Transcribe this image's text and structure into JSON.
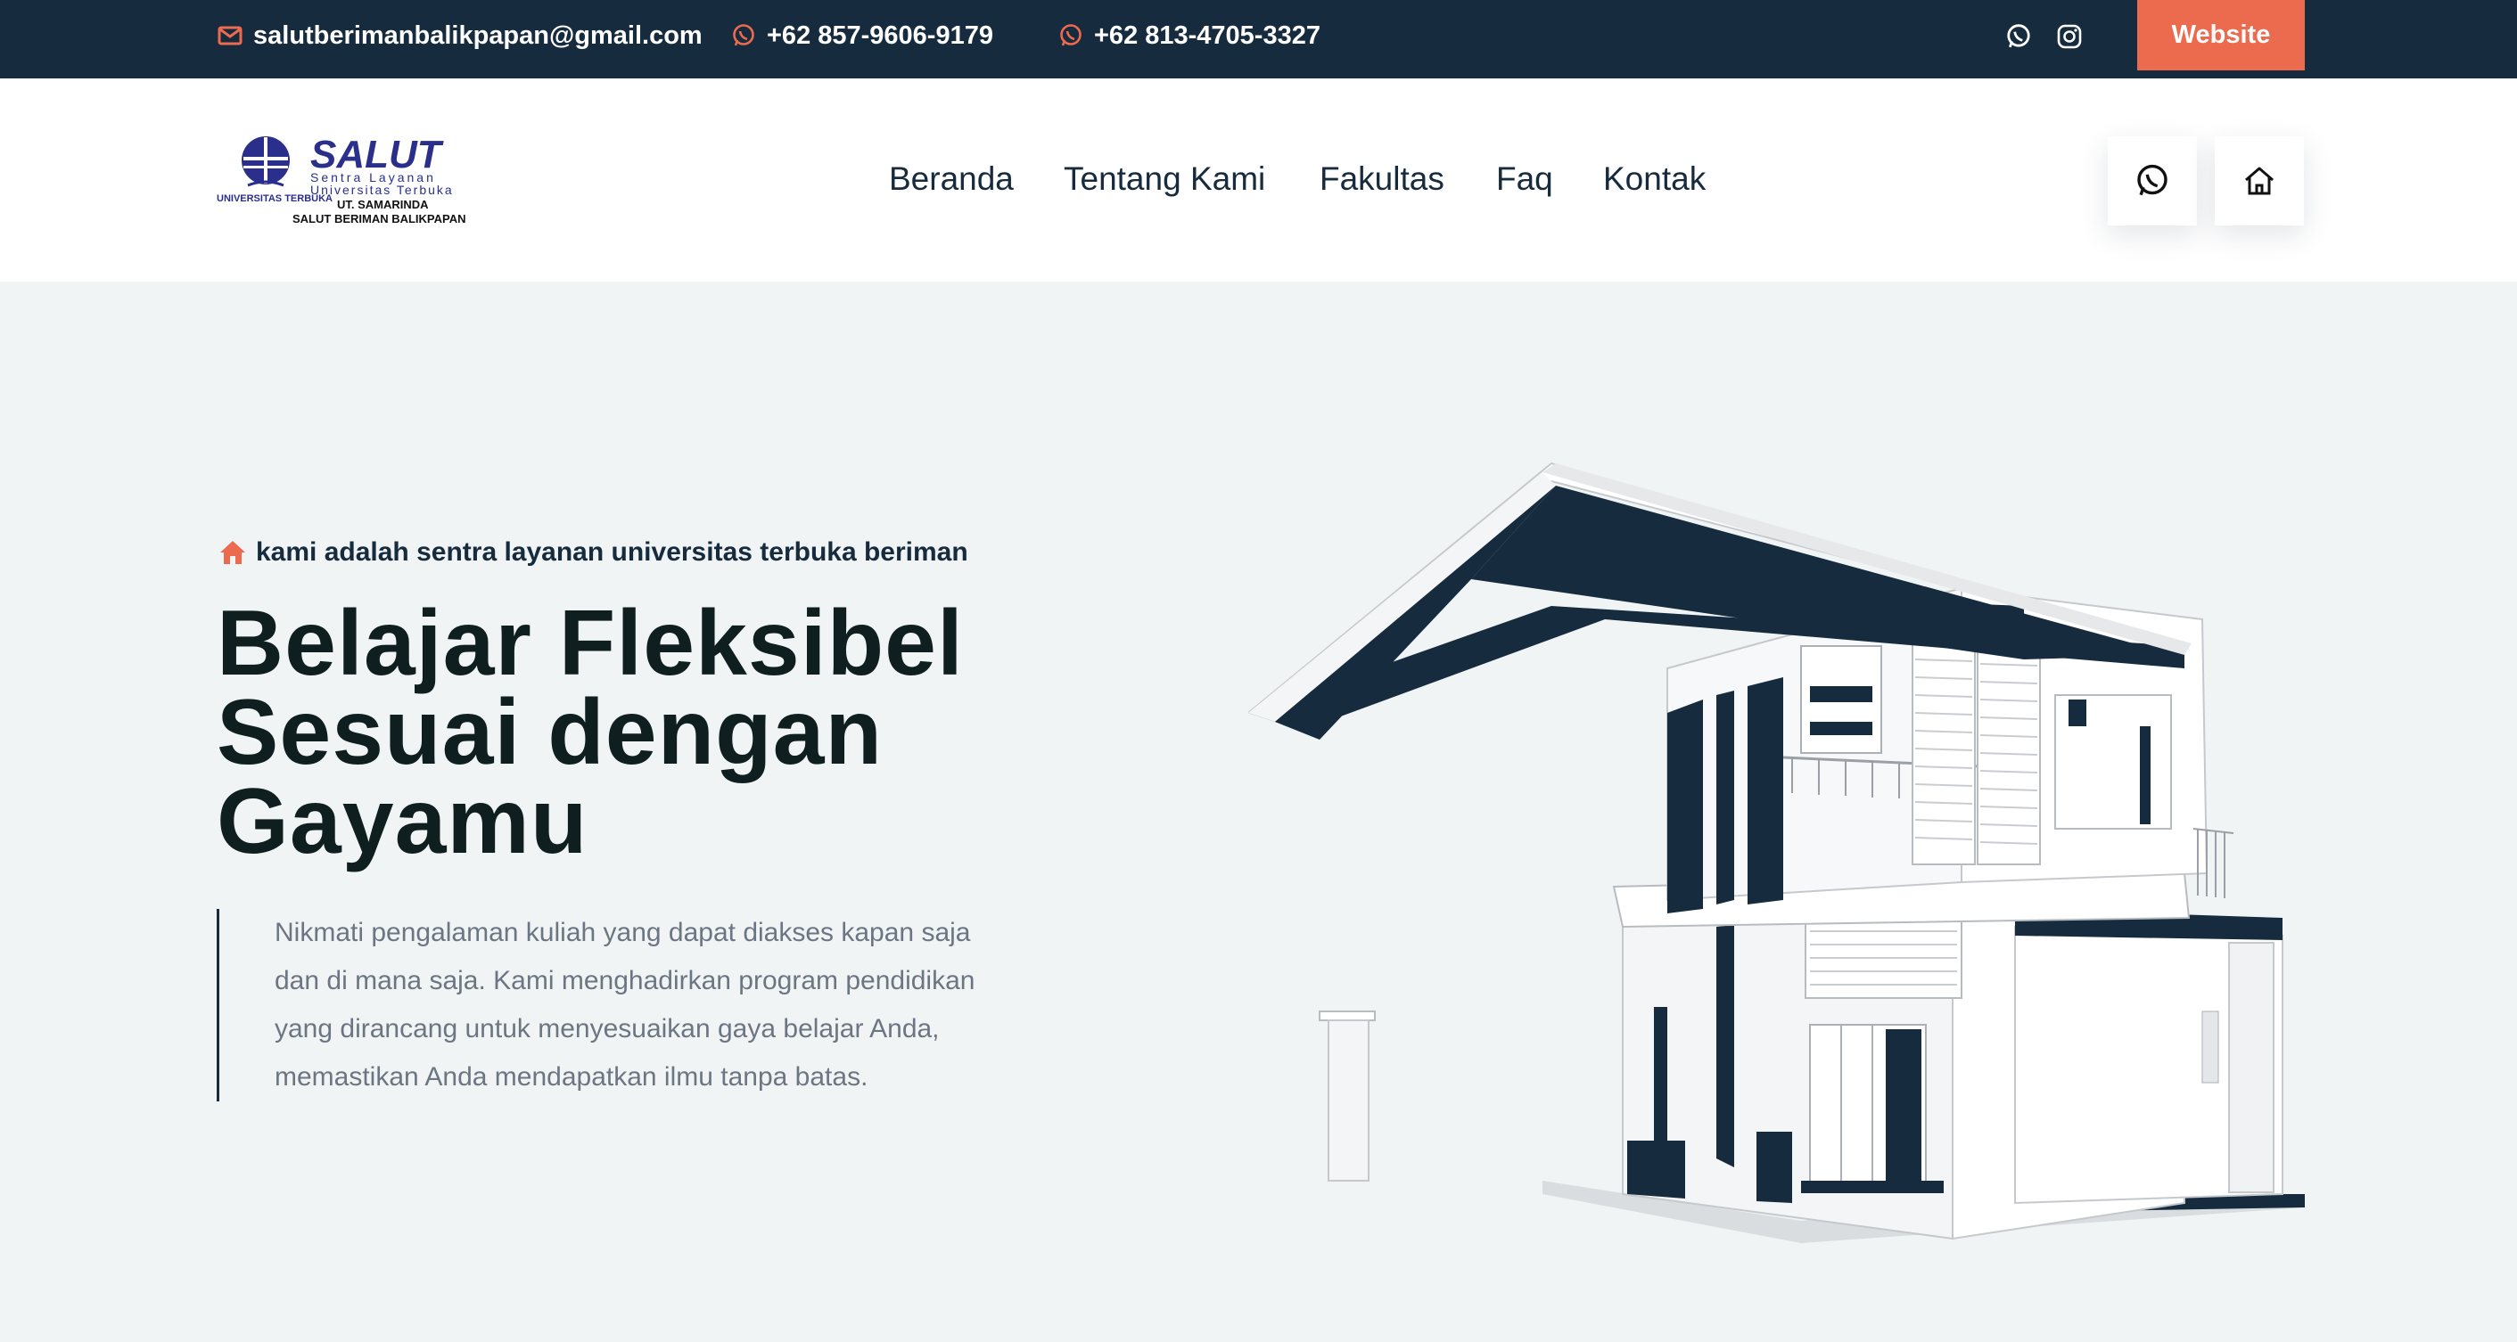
{
  "topbar": {
    "email": "salutberimanbalikpapan@gmail.com",
    "phone_1": "+62 857-9606-9179",
    "phone_2": "+62 813-4705-3327",
    "website_label": "Website",
    "icons": [
      "mail-icon",
      "whatsapp-icon",
      "instagram-icon"
    ]
  },
  "logo": {
    "title": "SALUT",
    "line1": "Sentra Layanan",
    "line2": "Universitas Terbuka",
    "ut_label": "UNIVERSITAS TERBUKA",
    "line3": "UT. SAMARINDA",
    "line4": "SALUT BERIMAN BALIKPAPAN"
  },
  "nav": {
    "items": [
      "Beranda",
      "Tentang Kami",
      "Fakultas",
      "Faq",
      "Kontak"
    ]
  },
  "hero": {
    "tagline": "kami adalah sentra layanan universitas terbuka beriman",
    "title_lines": [
      "Belajar Fleksibel",
      "Sesuai dengan",
      "Gayamu"
    ],
    "description_lines": [
      "Nikmati pengalaman kuliah yang dapat diakses kapan saja",
      "dan di mana saja. Kami menghadirkan program pendidikan",
      "yang dirancang untuk menyesuaikan gaya belajar Anda,",
      "memastikan Anda mendapatkan ilmu tanpa batas."
    ]
  },
  "colors": {
    "topbar_bg": "#162b3e",
    "accent": "#ec6a4e",
    "hero_bg": "#f1f4f5",
    "title": "#0f1f20",
    "muted": "#6c7683"
  }
}
